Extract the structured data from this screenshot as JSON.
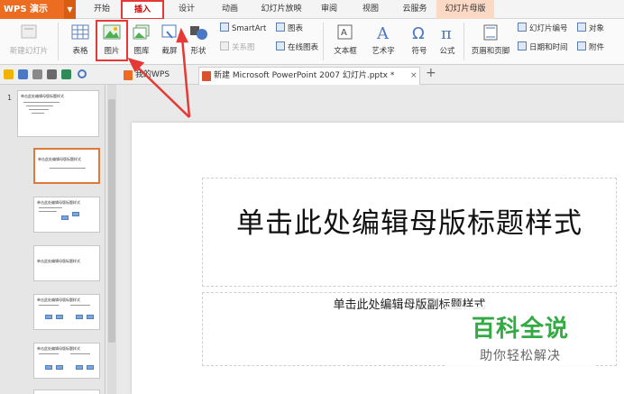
{
  "menubar": {
    "app_name": "WPS 演示",
    "tabs": [
      "开始",
      "插入",
      "设计",
      "动画",
      "幻灯片放映",
      "审阅",
      "视图",
      "云服务",
      "幻灯片母版"
    ]
  },
  "ribbon": {
    "new_slide": "新建幻灯片",
    "table": "表格",
    "picture": "图片",
    "gallery": "图库",
    "screenshot": "截屏",
    "shapes": "形状",
    "smartart": "SmartArt",
    "chart": "图表",
    "relationship": "关系图",
    "online_chart": "在线图表",
    "textbox": "文本框",
    "wordart": "艺术字",
    "symbol": "符号",
    "formula": "公式",
    "header_footer": "页眉和页脚",
    "slide_number": "幻灯片编号",
    "datetime": "日期和时间",
    "object": "对象",
    "attachment": "附件"
  },
  "doctabs": {
    "wps_tab": "我的WPS",
    "ppt_tab": "新建 Microsoft PowerPoint 2007 幻灯片.pptx *"
  },
  "thumbnails": {
    "master_number": "1",
    "master_title": "单击此处编辑母版标题样式",
    "layout_title": "单击此处编辑母版标题样式"
  },
  "slide": {
    "title": "单击此处编辑母版标题样式",
    "subtitle": "单击此处编辑母版副标题样式"
  },
  "watermark": {
    "title": "百科全说",
    "subtitle": "助你轻松解决"
  },
  "colors": {
    "app_orange": "#ec6d21",
    "highlight_red": "#e53935",
    "watermark_green": "#33aa44"
  }
}
